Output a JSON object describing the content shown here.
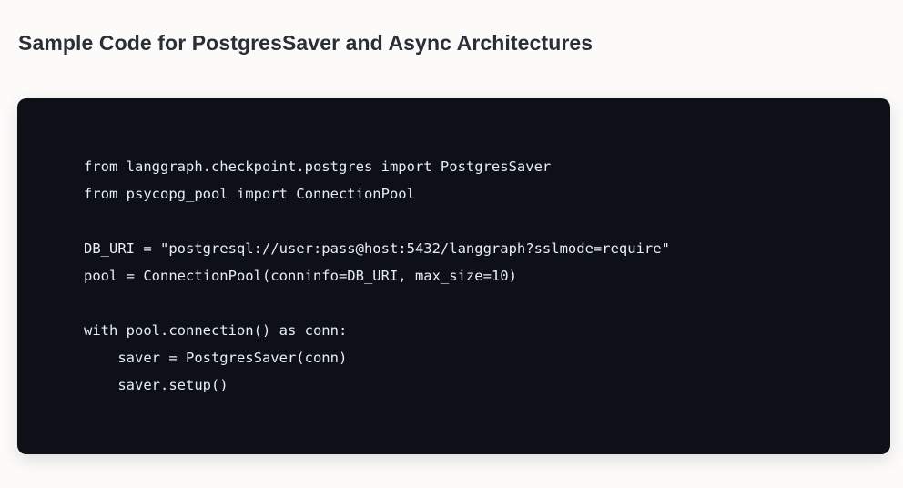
{
  "section": {
    "title": "Sample Code for PostgresSaver and Async Architectures"
  },
  "code": {
    "lines": [
      "from langgraph.checkpoint.postgres import PostgresSaver",
      "from psycopg_pool import ConnectionPool",
      "",
      "DB_URI = \"postgresql://user:pass@host:5432/langgraph?sslmode=require\"",
      "pool = ConnectionPool(conninfo=DB_URI, max_size=10)",
      "",
      "with pool.connection() as conn:",
      "    saver = PostgresSaver(conn)",
      "    saver.setup()"
    ]
  }
}
